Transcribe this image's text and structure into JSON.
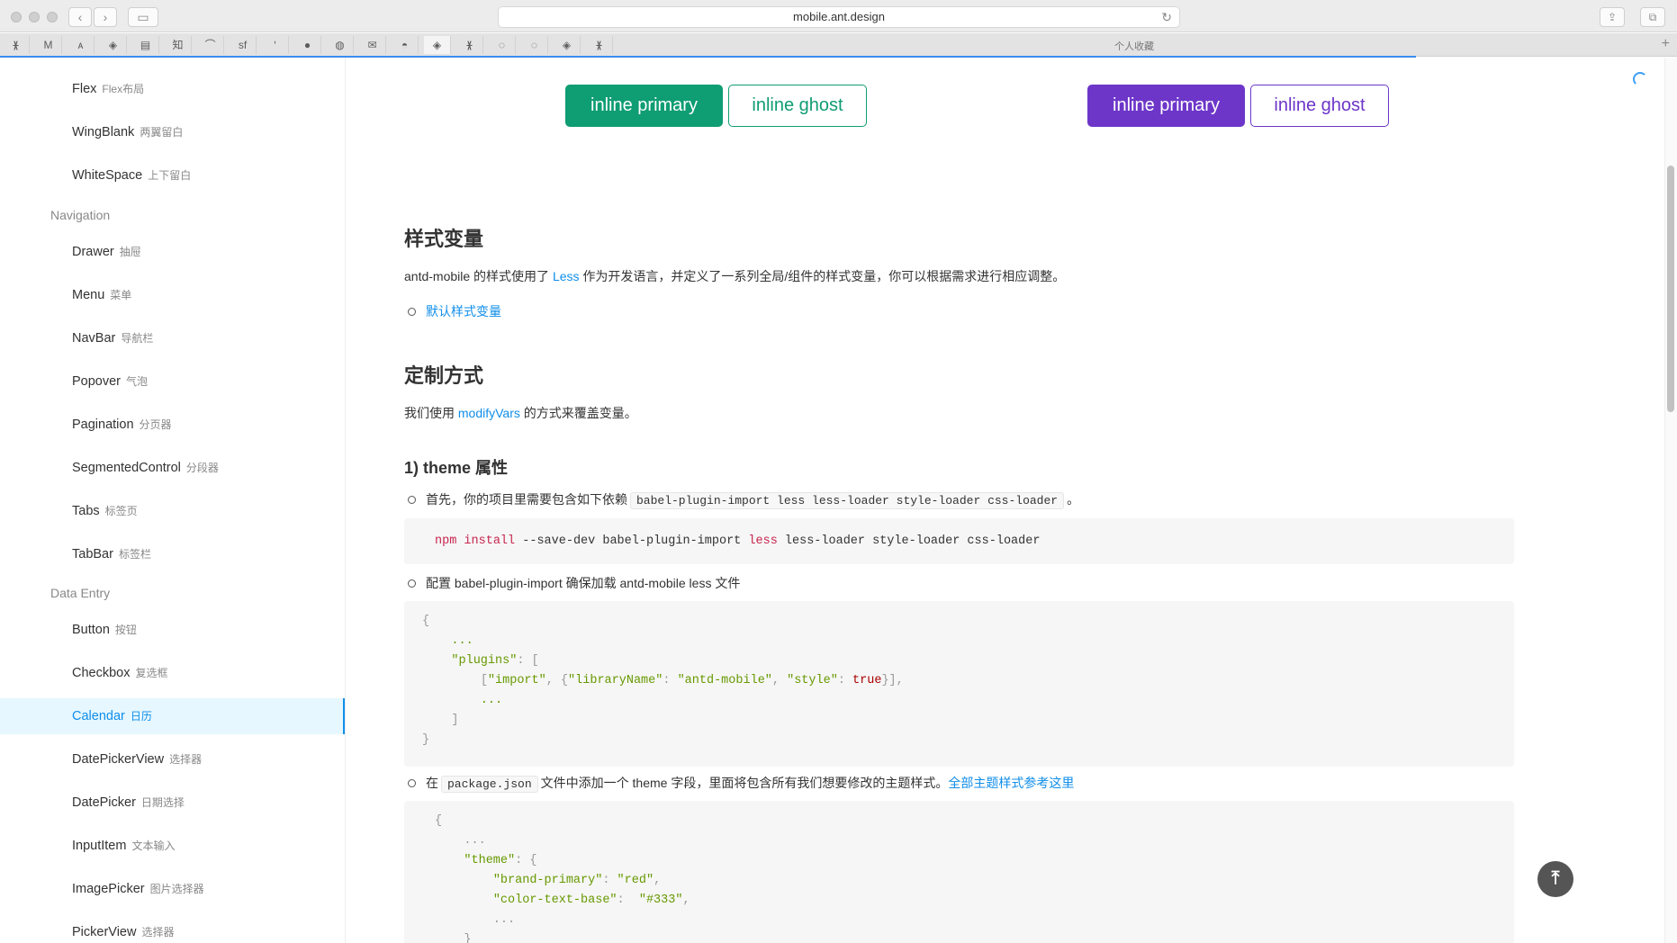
{
  "browser": {
    "url": "mobile.ant.design",
    "back_icon": "‹",
    "forward_icon": "›",
    "sidebar_toggle_icon": "▭",
    "reload_icon": "↻",
    "share_icon": "⇪",
    "tabs_icon": "⧉",
    "bookmarks_label": "个人收藏",
    "bookmark_icons": [
      "ᚕ",
      "M",
      "ᴀ",
      "◈",
      "▤",
      "知",
      "⌒",
      "sf",
      "ʹ",
      "●",
      "◍",
      "✉",
      "◓",
      "◈",
      "ᚕ",
      "◌",
      "◌",
      "◈",
      "ᚕ"
    ],
    "add_tab_icon": "+"
  },
  "sidebar": {
    "items": [
      {
        "label": "Flex",
        "zh": "Flex布局"
      },
      {
        "label": "WingBlank",
        "zh": "两翼留白"
      },
      {
        "label": "WhiteSpace",
        "zh": "上下留白"
      }
    ],
    "group_navigation": "Navigation",
    "nav_items": [
      {
        "label": "Drawer",
        "zh": "抽屉"
      },
      {
        "label": "Menu",
        "zh": "菜单"
      },
      {
        "label": "NavBar",
        "zh": "导航栏"
      },
      {
        "label": "Popover",
        "zh": "气泡"
      },
      {
        "label": "Pagination",
        "zh": "分页器"
      },
      {
        "label": "SegmentedControl",
        "zh": "分段器"
      },
      {
        "label": "Tabs",
        "zh": "标签页"
      },
      {
        "label": "TabBar",
        "zh": "标签栏"
      }
    ],
    "group_data_entry": "Data Entry",
    "entry_items": [
      {
        "label": "Button",
        "zh": "按钮"
      },
      {
        "label": "Checkbox",
        "zh": "复选框"
      },
      {
        "label": "Calendar",
        "zh": "日历"
      },
      {
        "label": "DatePickerView",
        "zh": "选择器"
      },
      {
        "label": "DatePicker",
        "zh": "日期选择"
      },
      {
        "label": "InputItem",
        "zh": "文本输入"
      },
      {
        "label": "ImagePicker",
        "zh": "图片选择器"
      },
      {
        "label": "PickerView",
        "zh": "选择器"
      }
    ]
  },
  "demo_buttons": {
    "green_primary": "inline primary",
    "green_ghost": "inline ghost",
    "purple_primary": "inline primary",
    "purple_ghost": "inline ghost",
    "green_color": "#0f9d73",
    "purple_color": "#6d36c9"
  },
  "content": {
    "h_style_vars": "样式变量",
    "p_style_vars_pre": "antd-mobile 的样式使用了 ",
    "p_style_vars_link": "Less",
    "p_style_vars_post": " 作为开发语言，并定义了一系列全局/组件的样式变量，你可以根据需求进行相应调整。",
    "link_default_vars": "默认样式变量",
    "h_customize": "定制方式",
    "p_customize_pre": "我们使用 ",
    "p_customize_link": "modifyVars",
    "p_customize_post": " 的方式来覆盖变量。",
    "h_theme": "1) theme 属性",
    "b1_pre": "首先，你的项目里需要包含如下依赖",
    "b1_code": "babel-plugin-import less less-loader style-loader css-loader",
    "b1_post": "。",
    "npm_cmd": "npm",
    "npm_install": "install",
    "npm_flags": " --save-dev babel-plugin-import ",
    "npm_less": "less",
    "npm_rest": " less-loader style-loader css-loader",
    "b2_text": "配置 babel-plugin-import 确保加载 antd-mobile less 文件",
    "code2_l1": "{",
    "code2_l2": "    ...",
    "code2_plugins": "\"plugins\"",
    "code2_l3_rest": ": [",
    "code2_l4_a": "\"import\"",
    "code2_l4_b": "\"libraryName\"",
    "code2_l4_c": "\"antd-mobile\"",
    "code2_l4_d": "\"style\"",
    "code2_l4_e": "true",
    "code2_l5": "        ...",
    "code2_l6": "    ]",
    "code2_l7": "}",
    "b3_pre": "在",
    "b3_code": "package.json",
    "b3_mid": "文件中添加一个 theme 字段，里面将包含所有我们想要修改的主题样式。",
    "b3_link": "全部主题样式参考这里",
    "code3_l1": "{",
    "code3_l2": "    ...",
    "code3_theme": "\"theme\"",
    "code3_l3_rest": ": {",
    "code3_k1": "\"brand-primary\"",
    "code3_v1": "\"red\"",
    "code3_k2": "\"color-text-base\"",
    "code3_v2": "\"#333\"",
    "code3_l6": "        ...",
    "code3_l7": "    }"
  },
  "back_to_top_icon": "⤒"
}
